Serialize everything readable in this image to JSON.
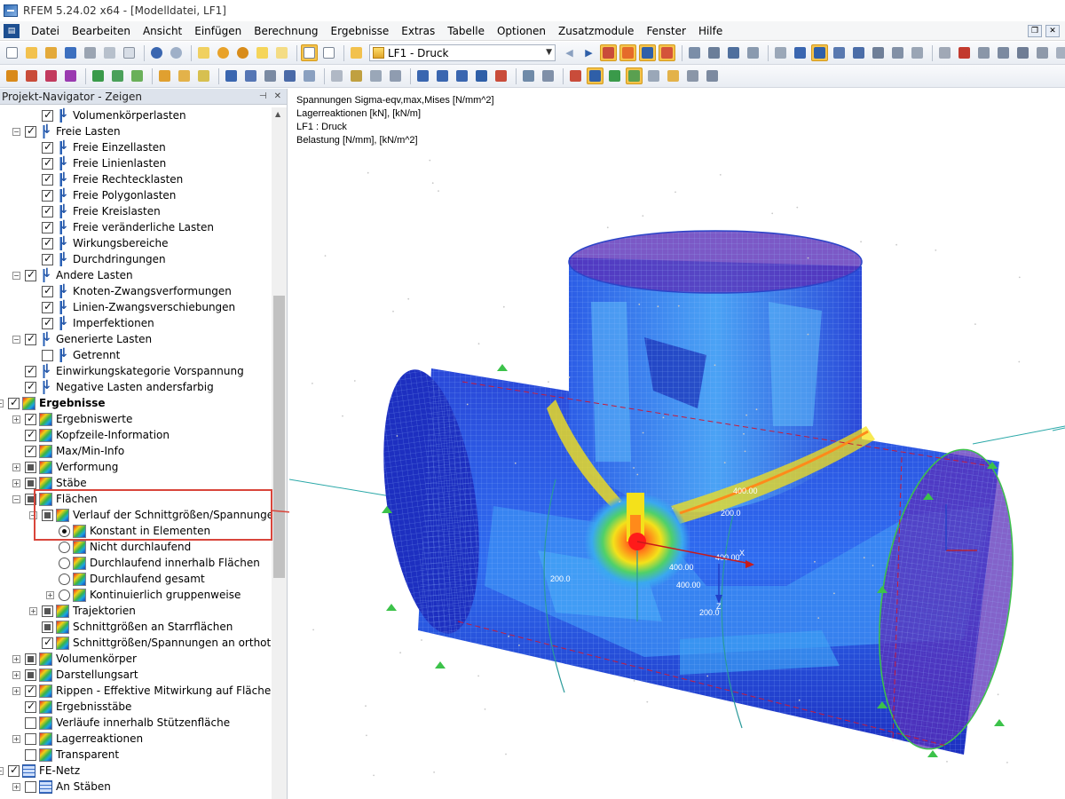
{
  "window": {
    "title": "RFEM 5.24.02 x64 - [Modelldatei, LF1]"
  },
  "menu": {
    "items": [
      "Datei",
      "Bearbeiten",
      "Ansicht",
      "Einfügen",
      "Berechnung",
      "Ergebnisse",
      "Extras",
      "Tabelle",
      "Optionen",
      "Zusatzmodule",
      "Fenster",
      "Hilfe"
    ]
  },
  "toolbar": {
    "load_case": "LF1 - Druck"
  },
  "navigator": {
    "title": "Projekt-Navigator - Zeigen",
    "pin_icon": "pin-icon",
    "close_icon": "close-icon",
    "rows": [
      {
        "label": "Volumenkörperlasten",
        "indent": 3,
        "control": "checkbox",
        "state": "checked",
        "icon": "load"
      },
      {
        "label": "Freie Lasten",
        "indent": 2,
        "control": "checkbox",
        "state": "checked",
        "icon": "load",
        "expander": "−"
      },
      {
        "label": "Freie Einzellasten",
        "indent": 3,
        "control": "checkbox",
        "state": "checked",
        "icon": "load"
      },
      {
        "label": "Freie Linienlasten",
        "indent": 3,
        "control": "checkbox",
        "state": "checked",
        "icon": "load"
      },
      {
        "label": "Freie Rechtecklasten",
        "indent": 3,
        "control": "checkbox",
        "state": "checked",
        "icon": "load"
      },
      {
        "label": "Freie Polygonlasten",
        "indent": 3,
        "control": "checkbox",
        "state": "checked",
        "icon": "load"
      },
      {
        "label": "Freie Kreislasten",
        "indent": 3,
        "control": "checkbox",
        "state": "checked",
        "icon": "load"
      },
      {
        "label": "Freie veränderliche Lasten",
        "indent": 3,
        "control": "checkbox",
        "state": "checked",
        "icon": "load"
      },
      {
        "label": "Wirkungsbereiche",
        "indent": 3,
        "control": "checkbox",
        "state": "checked",
        "icon": "load"
      },
      {
        "label": "Durchdringungen",
        "indent": 3,
        "control": "checkbox",
        "state": "checked",
        "icon": "load"
      },
      {
        "label": "Andere Lasten",
        "indent": 2,
        "control": "checkbox",
        "state": "checked",
        "icon": "load",
        "expander": "−"
      },
      {
        "label": "Knoten-Zwangsverformungen",
        "indent": 3,
        "control": "checkbox",
        "state": "checked",
        "icon": "load"
      },
      {
        "label": "Linien-Zwangsverschiebungen",
        "indent": 3,
        "control": "checkbox",
        "state": "checked",
        "icon": "load"
      },
      {
        "label": "Imperfektionen",
        "indent": 3,
        "control": "checkbox",
        "state": "checked",
        "icon": "load"
      },
      {
        "label": "Generierte Lasten",
        "indent": 2,
        "control": "checkbox",
        "state": "checked",
        "icon": "load",
        "expander": "−"
      },
      {
        "label": "Getrennt",
        "indent": 3,
        "control": "checkbox",
        "state": "unchecked",
        "icon": "load"
      },
      {
        "label": "Einwirkungskategorie Vorspannung",
        "indent": 2,
        "control": "checkbox",
        "state": "checked",
        "icon": "load"
      },
      {
        "label": "Negative Lasten andersfarbig",
        "indent": 2,
        "control": "checkbox",
        "state": "checked",
        "icon": "load"
      },
      {
        "label": "Ergebnisse",
        "indent": 1,
        "control": "checkbox",
        "state": "checked",
        "icon": "result",
        "expander": "−",
        "bold": true
      },
      {
        "label": "Ergebniswerte",
        "indent": 2,
        "control": "checkbox",
        "state": "checked",
        "icon": "result",
        "expander": "+"
      },
      {
        "label": "Kopfzeile-Information",
        "indent": 2,
        "control": "checkbox",
        "state": "checked",
        "icon": "result"
      },
      {
        "label": "Max/Min-Info",
        "indent": 2,
        "control": "checkbox",
        "state": "checked",
        "icon": "result"
      },
      {
        "label": "Verformung",
        "indent": 2,
        "control": "checkbox",
        "state": "partial",
        "icon": "result",
        "expander": "+"
      },
      {
        "label": "Stäbe",
        "indent": 2,
        "control": "checkbox",
        "state": "partial",
        "icon": "result",
        "expander": "+"
      },
      {
        "label": "Flächen",
        "indent": 2,
        "control": "checkbox",
        "state": "partial",
        "icon": "result",
        "expander": "−"
      },
      {
        "label": "Verlauf der Schnittgrößen/Spannungen",
        "indent": 3,
        "control": "checkbox",
        "state": "partial",
        "icon": "result",
        "expander": "−"
      },
      {
        "label": "Konstant in Elementen",
        "indent": 4,
        "control": "radio",
        "state": "selected",
        "icon": "result"
      },
      {
        "label": "Nicht durchlaufend",
        "indent": 4,
        "control": "radio",
        "state": "unselected",
        "icon": "result"
      },
      {
        "label": "Durchlaufend innerhalb Flächen",
        "indent": 4,
        "control": "radio",
        "state": "unselected",
        "icon": "result"
      },
      {
        "label": "Durchlaufend gesamt",
        "indent": 4,
        "control": "radio",
        "state": "unselected",
        "icon": "result"
      },
      {
        "label": "Kontinuierlich gruppenweise",
        "indent": 4,
        "control": "radio",
        "state": "unselected",
        "icon": "result",
        "expander": "+"
      },
      {
        "label": "Trajektorien",
        "indent": 3,
        "control": "checkbox",
        "state": "partial",
        "icon": "result",
        "expander": "+"
      },
      {
        "label": "Schnittgrößen an Starrflächen",
        "indent": 3,
        "control": "checkbox",
        "state": "partial",
        "icon": "result"
      },
      {
        "label": "Schnittgrößen/Spannungen an orthotro",
        "indent": 3,
        "control": "checkbox",
        "state": "checked",
        "icon": "result"
      },
      {
        "label": "Volumenkörper",
        "indent": 2,
        "control": "checkbox",
        "state": "partial",
        "icon": "result",
        "expander": "+"
      },
      {
        "label": "Darstellungsart",
        "indent": 2,
        "control": "checkbox",
        "state": "partial",
        "icon": "result",
        "expander": "+"
      },
      {
        "label": "Rippen - Effektive Mitwirkung auf Fläche/S",
        "indent": 2,
        "control": "checkbox",
        "state": "checked",
        "icon": "result",
        "expander": "+"
      },
      {
        "label": "Ergebnisstäbe",
        "indent": 2,
        "control": "checkbox",
        "state": "checked",
        "icon": "result"
      },
      {
        "label": "Verläufe innerhalb Stützenfläche",
        "indent": 2,
        "control": "checkbox",
        "state": "unchecked",
        "icon": "result"
      },
      {
        "label": "Lagerreaktionen",
        "indent": 2,
        "control": "checkbox",
        "state": "unchecked",
        "icon": "result",
        "expander": "+"
      },
      {
        "label": "Transparent",
        "indent": 2,
        "control": "checkbox",
        "state": "unchecked",
        "icon": "result"
      },
      {
        "label": "FE-Netz",
        "indent": 1,
        "control": "checkbox",
        "state": "checked",
        "icon": "mesh",
        "expander": "−"
      },
      {
        "label": "An Stäben",
        "indent": 2,
        "control": "checkbox",
        "state": "unchecked",
        "icon": "mesh",
        "expander": "+"
      }
    ]
  },
  "viewport": {
    "header_lines": [
      "Spannungen Sigma-eqv,max,Mises [N/mm^2]",
      "Lagerreaktionen [kN], [kN/m]",
      "LF1 : Druck",
      "Belastung [N/mm], [kN/m^2]"
    ],
    "dimension_labels": [
      "400.00",
      "200.0",
      "400.00",
      "400.00",
      "400.00",
      "200.0",
      "200.0"
    ],
    "axis_labels": [
      "X",
      "Z"
    ]
  },
  "colors": {
    "highlight": "#d9453b",
    "mesh_dark": "#1d2fc0",
    "mesh_mid": "#2f6cf0",
    "mesh_light": "#4ba3f5",
    "hot": "#ff1a1a"
  }
}
